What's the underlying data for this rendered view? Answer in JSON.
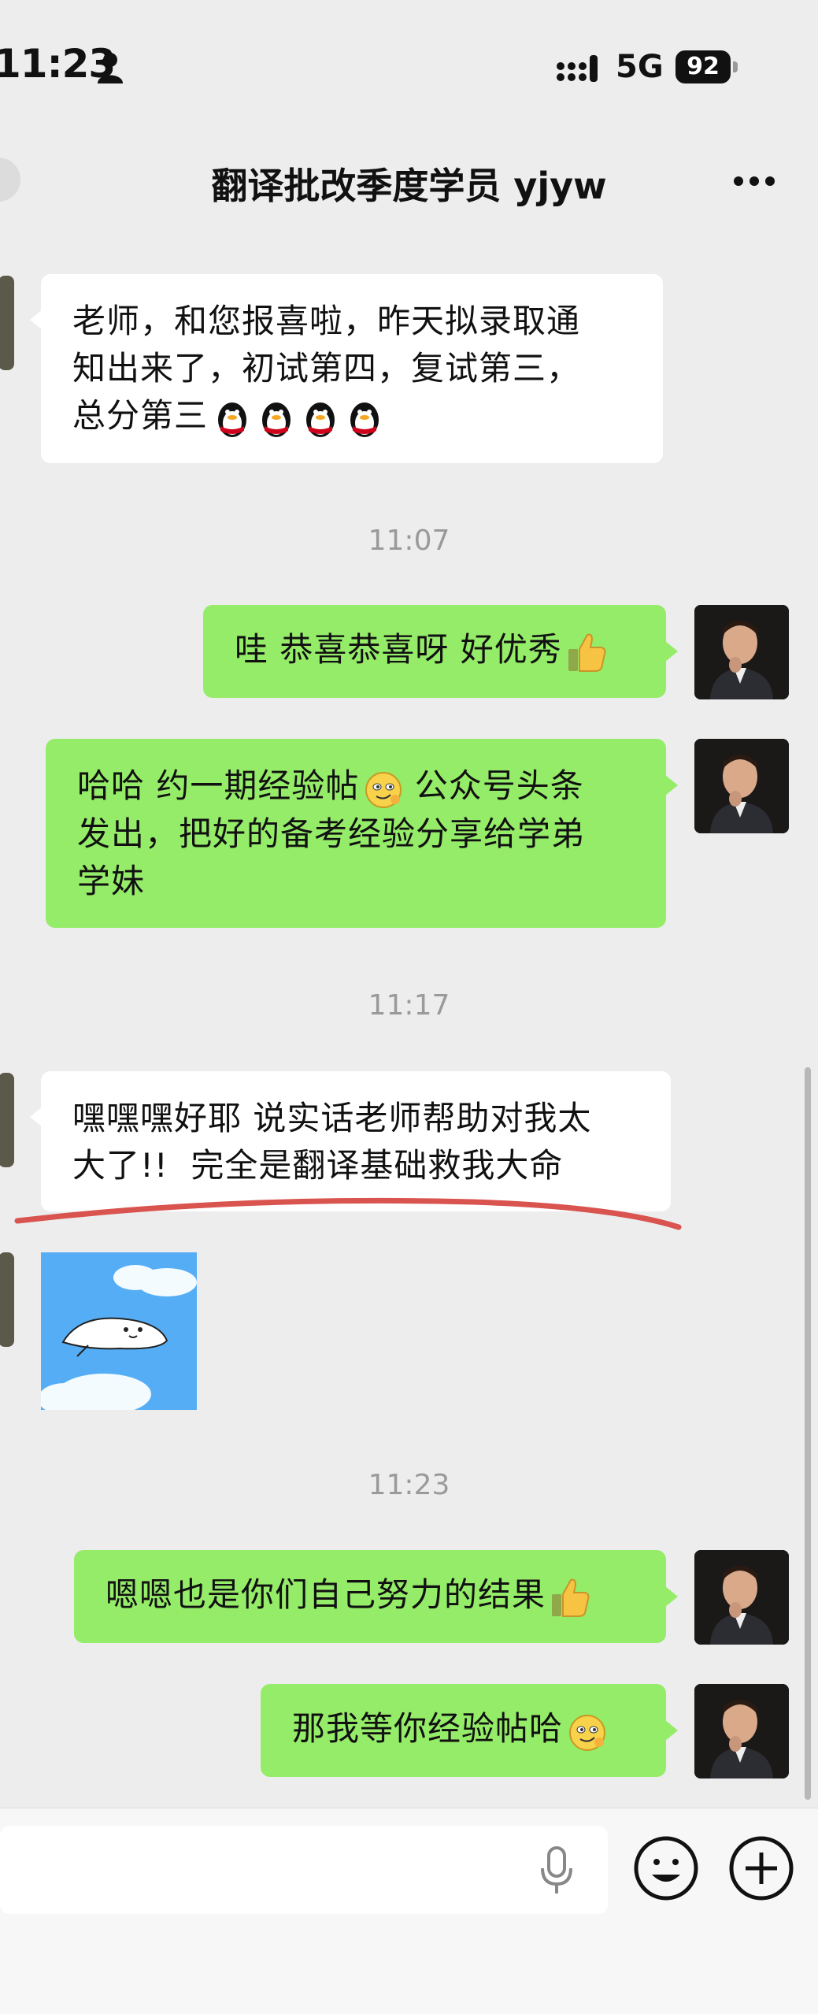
{
  "status_bar": {
    "time": "11:23",
    "network": "5G",
    "battery": "92",
    "icons": [
      "person-icon",
      "signal-icon"
    ]
  },
  "header": {
    "title": "翻译批改季度学员 yjyw",
    "back_icon": "back-icon",
    "more_icon": "more-icon"
  },
  "messages": [
    {
      "type": "text",
      "side": "in",
      "lines": [
        "老师，和您报喜啦，昨天拟录取通",
        "知出来了，初试第四，复试第三，",
        "总分第三"
      ],
      "trailing_icons": [
        "qq-penguin-icon",
        "qq-penguin-icon",
        "qq-penguin-icon",
        "qq-penguin-icon"
      ]
    },
    {
      "type": "time",
      "text": "11:07"
    },
    {
      "type": "text",
      "side": "out",
      "lines": [
        "哇 恭喜恭喜呀 好优秀"
      ],
      "trailing_icons": [
        "thumbs-up-icon"
      ]
    },
    {
      "type": "text",
      "side": "out",
      "lines": [
        "哈哈 约一期经验帖",
        "发出，把好的备考经验分享给学弟",
        "学妹"
      ],
      "inline_icon_text": "公众号头条",
      "inline_icons": [
        "smirk-emoji-icon"
      ]
    },
    {
      "type": "time",
      "text": "11:17"
    },
    {
      "type": "text",
      "side": "in",
      "lines": [
        "嘿嘿嘿好耶 说实话老师帮助对我太",
        "大了!!  完全是翻译基础救我大命"
      ]
    },
    {
      "type": "sticker",
      "side": "in",
      "icon": "seal-sticker-icon"
    },
    {
      "type": "time",
      "text": "11:23"
    },
    {
      "type": "text",
      "side": "out",
      "lines": [
        "嗯嗯也是你们自己努力的结果"
      ],
      "trailing_icons": [
        "thumbs-up-icon"
      ]
    },
    {
      "type": "text",
      "side": "out",
      "lines": [
        "那我等你经验帖哈"
      ],
      "trailing_icons": [
        "smirk-emoji-icon"
      ]
    }
  ],
  "input_bar": {
    "placeholder": "",
    "icons": [
      "microphone-icon",
      "emoji-icon",
      "plus-icon"
    ]
  },
  "colors": {
    "background": "#ededed",
    "incoming_bubble": "#ffffff",
    "outgoing_bubble": "#95ec69",
    "timestamp_text": "#9a9a9a",
    "annotation_red": "#d9534f"
  }
}
